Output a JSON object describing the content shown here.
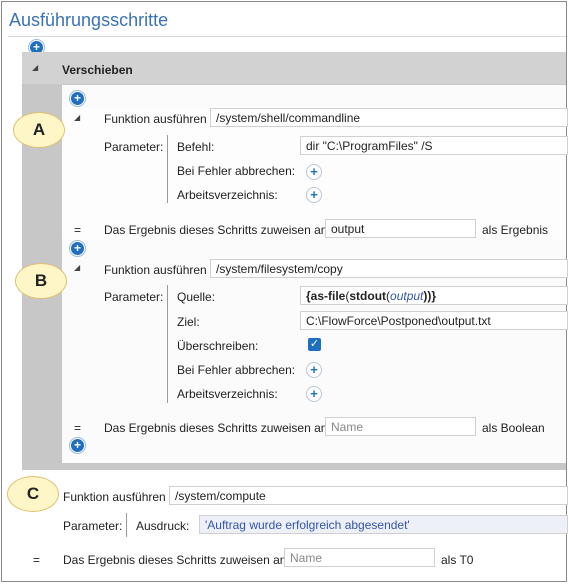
{
  "title": "Ausführungsschritte",
  "block": {
    "title": "Verschieben"
  },
  "stepA": {
    "badge": "A",
    "func_label": "Funktion ausführen",
    "func_value": "/system/shell/commandline",
    "params_label": "Parameter:",
    "p1_label": "Befehl:",
    "p1_value": "dir \"C:\\ProgramFiles\" /S",
    "p2_label": "Bei Fehler abbrechen:",
    "p3_label": "Arbeitsverzeichnis:",
    "eq": "=",
    "assign_label": "Das Ergebnis dieses Schritts zuweisen an",
    "assign_value": "output",
    "result_label": "als Ergebnis"
  },
  "stepB": {
    "badge": "B",
    "func_label": "Funktion ausführen",
    "func_value": "/system/filesystem/copy",
    "params_label": "Parameter:",
    "p1_label": "Quelle:",
    "p1_open": "{",
    "p1_fn": "as-file",
    "p1_lp": "(",
    "p1_inner_fn": "stdout",
    "p1_lp2": "(",
    "p1_arg": "output",
    "p1_close": "))}",
    "p2_label": "Ziel:",
    "p2_value": "C:\\FlowForce\\Postponed\\output.txt",
    "p3_label": "Überschreiben:",
    "p3_checked": "✓",
    "p4_label": "Bei Fehler abbrechen:",
    "p5_label": "Arbeitsverzeichnis:",
    "eq": "=",
    "assign_label": "Das Ergebnis dieses Schritts zuweisen an",
    "assign_placeholder": "Name",
    "result_label": "als Boolean"
  },
  "stepC": {
    "badge": "C",
    "func_label": "Funktion ausführen",
    "func_value": "/system/compute",
    "params_label": "Parameter:",
    "p1_label": "Ausdruck:",
    "p1_value": "'Auftrag wurde erfolgreich abgesendet'",
    "eq": "=",
    "assign_label": "Das Ergebnis dieses Schritts zuweisen an",
    "assign_placeholder": "Name",
    "result_label": "als T0"
  },
  "icons": {
    "plus": "+",
    "collapse": "◢"
  }
}
